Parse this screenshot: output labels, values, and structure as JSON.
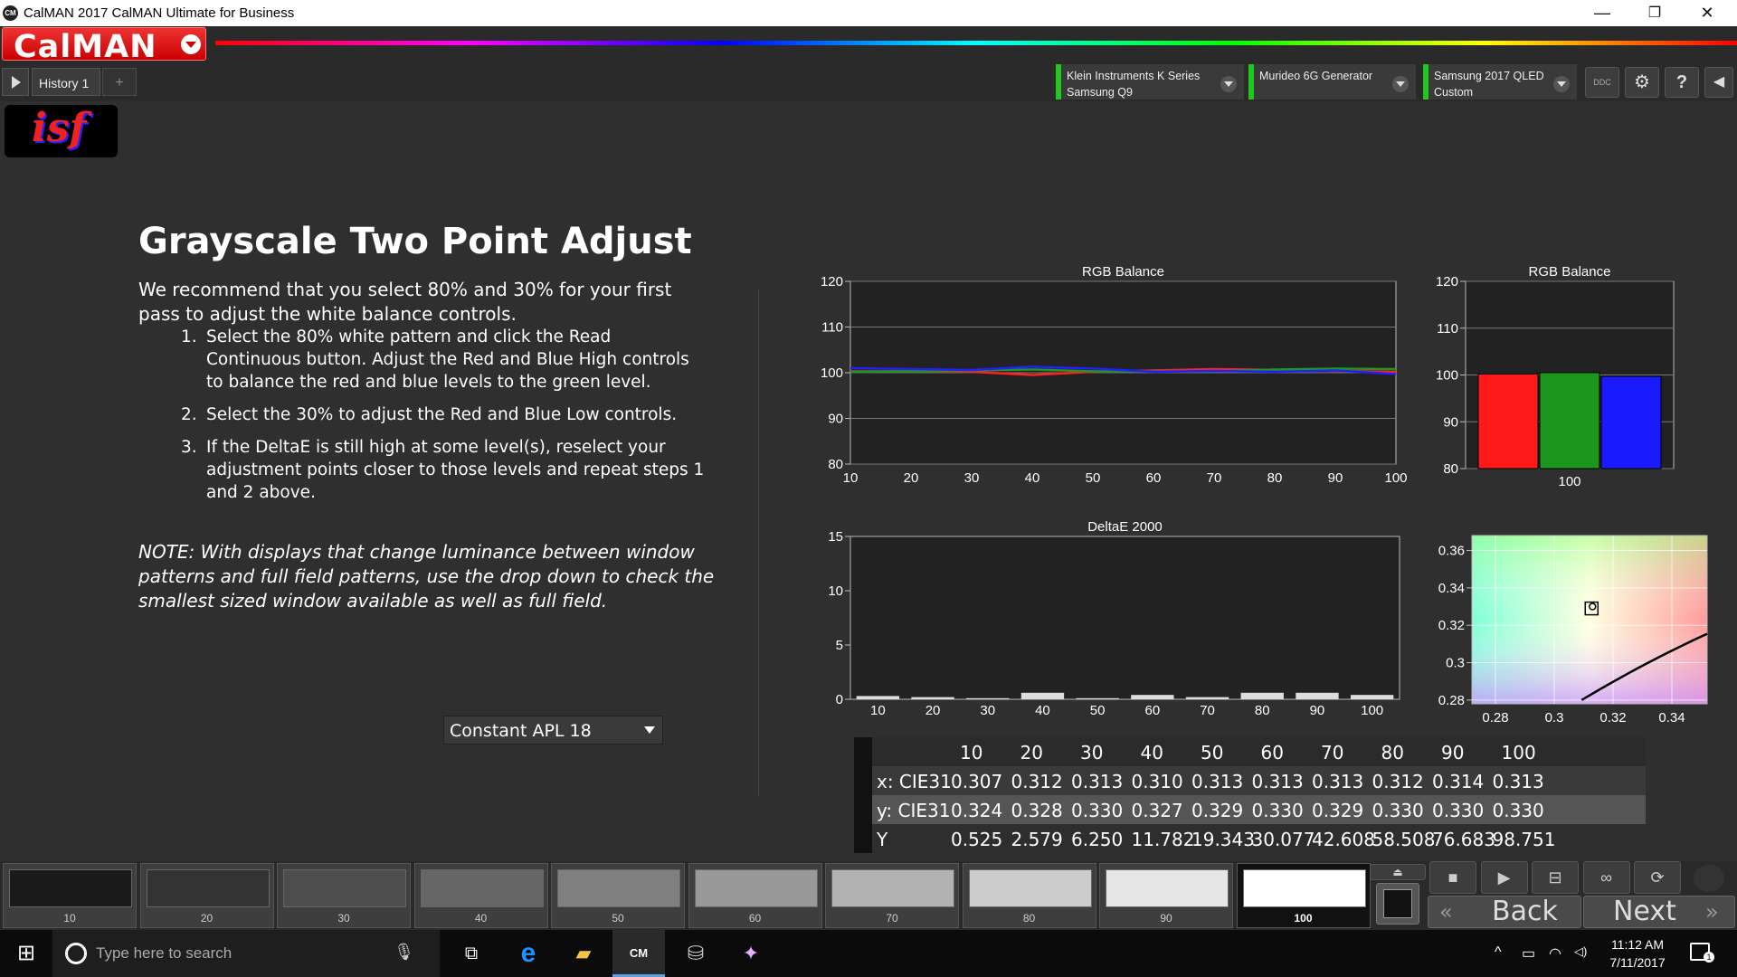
{
  "window": {
    "title": "CalMAN 2017 CalMAN Ultimate for Business",
    "app_icon": "CM",
    "minimize": "—",
    "maximize": "❐",
    "close": "✕"
  },
  "logo": {
    "text": "CalMAN"
  },
  "tabs": {
    "history": "History 1",
    "add": "+"
  },
  "devices": [
    {
      "line1": "Klein Instruments K Series",
      "line2": "Samsung Q9"
    },
    {
      "line1": "Murideo 6G Generator",
      "line2": ""
    },
    {
      "line1": "Samsung 2017 QLED",
      "line2": "Custom"
    }
  ],
  "toolbar_icons": {
    "ddc": "DDC",
    "settings": "⚙",
    "help": "?",
    "collapse": "◀"
  },
  "isf_logo": "isf",
  "page": {
    "heading": "Grayscale Two Point Adjust",
    "intro": "We recommend that you select 80% and 30% for your first pass to adjust the white balance  controls.",
    "steps": [
      {
        "num": "1.",
        "text": "Select the 80% white pattern and click the Read Continuous button. Adjust the Red and Blue High controls to balance the red and blue levels to the green level."
      },
      {
        "num": "2.",
        "text": "Select the 30% to adjust the Red and Blue Low controls."
      },
      {
        "num": "3.",
        "text": "If the DeltaE is still high at some level(s), reselect your adjustment points closer to those levels and repeat steps 1 and 2 above."
      }
    ],
    "note": "NOTE: With displays that change luminance between window patterns and full field patterns, use the drop down to check the smallest sized window available as well as full field.",
    "apl_select": "Constant APL 18"
  },
  "colors": {
    "red": "#ff2020",
    "green": "#1c9a1c",
    "blue": "#2020ff",
    "bar_red": "#ff1a1a",
    "bar_green": "#1c961c",
    "bar_blue": "#1a1aff",
    "device_accent": "#1ec81e"
  },
  "chart_data": [
    {
      "type": "line",
      "title": "RGB Balance",
      "x": [
        10,
        20,
        30,
        40,
        50,
        60,
        70,
        80,
        90,
        100
      ],
      "ylim": [
        80,
        120
      ],
      "yticks": [
        80,
        90,
        100,
        110,
        120
      ],
      "series": [
        {
          "values": [
            100.3,
            100.3,
            100.2,
            99.5,
            100.2,
            100.5,
            100.8,
            100.6,
            100.4,
            100.2
          ]
        },
        {
          "values": [
            100.2,
            100.3,
            100.5,
            100.7,
            100.3,
            100.3,
            100.3,
            100.7,
            100.9,
            100.8
          ]
        },
        {
          "values": [
            101.0,
            100.8,
            100.6,
            101.3,
            100.9,
            100.2,
            100.4,
            100.2,
            100.5,
            99.7
          ]
        }
      ]
    },
    {
      "type": "bar",
      "title": "RGB Balance",
      "categories": [
        "100"
      ],
      "ylim": [
        80,
        120
      ],
      "yticks": [
        80,
        90,
        100,
        110,
        120
      ],
      "series": [
        {
          "values": [
            100.2
          ]
        },
        {
          "values": [
            100.5
          ]
        },
        {
          "values": [
            99.7
          ]
        }
      ]
    },
    {
      "type": "bar",
      "title": "DeltaE 2000",
      "categories": [
        "10",
        "20",
        "30",
        "40",
        "50",
        "60",
        "70",
        "80",
        "90",
        "100"
      ],
      "ylim": [
        0,
        15
      ],
      "yticks": [
        0,
        5,
        10,
        15
      ],
      "values": [
        0.3,
        0.2,
        0.1,
        0.6,
        0.1,
        0.4,
        0.2,
        0.6,
        0.6,
        0.4
      ]
    },
    {
      "type": "scatter",
      "title": "",
      "xlim": [
        0.272,
        0.352
      ],
      "ylim": [
        0.278,
        0.368
      ],
      "xticks": [
        0.28,
        0.3,
        0.32,
        0.34
      ],
      "xtick_labels": [
        "0.28",
        "0.3",
        "0.32",
        "0.34"
      ],
      "yticks": [
        0.28,
        0.3,
        0.32,
        0.34,
        0.36
      ],
      "ytick_labels": [
        "0.28",
        "0.3",
        "0.32",
        "0.34",
        "0.36"
      ],
      "target": {
        "x": 0.3127,
        "y": 0.329
      },
      "measured": {
        "x": 0.313,
        "y": 0.33
      }
    }
  ],
  "table": {
    "headers": [
      "10",
      "20",
      "30",
      "40",
      "50",
      "60",
      "70",
      "80",
      "90",
      "100"
    ],
    "rows": [
      {
        "label": "x: CIE31",
        "values": [
          "0.307",
          "0.312",
          "0.313",
          "0.310",
          "0.313",
          "0.313",
          "0.313",
          "0.312",
          "0.314",
          "0.313"
        ]
      },
      {
        "label": "y: CIE31",
        "values": [
          "0.324",
          "0.328",
          "0.330",
          "0.327",
          "0.329",
          "0.330",
          "0.329",
          "0.330",
          "0.330",
          "0.330"
        ]
      },
      {
        "label": "Y",
        "values": [
          "0.525",
          "2.579",
          "6.250",
          "11.782",
          "19.343",
          "30.077",
          "42.608",
          "58.508",
          "76.683",
          "98.751"
        ]
      }
    ]
  },
  "swatches": {
    "labels": [
      "10",
      "20",
      "30",
      "40",
      "50",
      "60",
      "70",
      "80",
      "90",
      "100"
    ],
    "grays": [
      "#1a1a1a",
      "#333333",
      "#4d4d4d",
      "#666666",
      "#808080",
      "#999999",
      "#b3b3b3",
      "#cccccc",
      "#e6e6e6",
      "#ffffff"
    ],
    "selected": "100"
  },
  "controls": {
    "icons": [
      "■",
      "▶",
      "⊟",
      "∞",
      "⟳"
    ],
    "back_label": "Back",
    "next_label": "Next",
    "back_chevron": "«",
    "next_chevron": "»"
  },
  "taskbar": {
    "search_placeholder": "Type here to search",
    "time": "11:12 AM",
    "date": "7/11/2017",
    "notifications": "1",
    "icons": [
      "⧉",
      "e",
      "▰",
      "CM",
      "⛁",
      "✦"
    ],
    "tray": [
      "^",
      "▭",
      "◠",
      "◁)"
    ]
  }
}
